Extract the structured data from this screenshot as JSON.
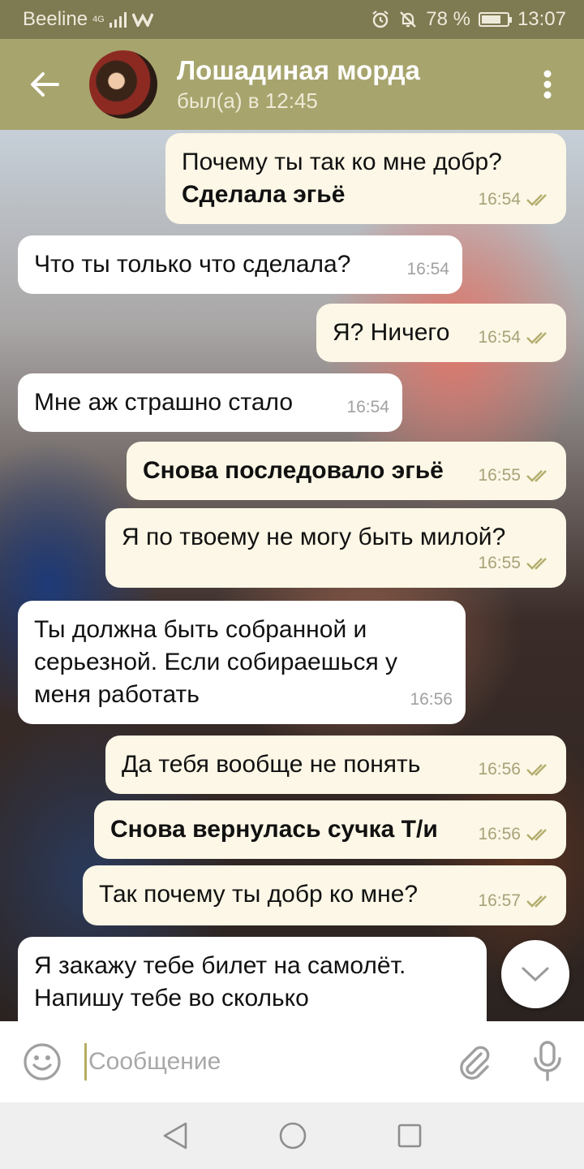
{
  "status_bar": {
    "carrier": "Beeline",
    "network": "4G",
    "battery": "78 %",
    "battery_level": 0.78,
    "time": "13:07"
  },
  "header": {
    "title": "Лошадиная морда",
    "subtitle": "был(а) в 12:45"
  },
  "messages": [
    {
      "direction": "out",
      "lines": [
        "Почему ты так ко мне добр?"
      ],
      "bold": "Сделала эгьё",
      "time": "16:54",
      "read": true
    },
    {
      "direction": "in",
      "lines": [
        "Что ты только что сделала?"
      ],
      "time": "16:54"
    },
    {
      "direction": "out",
      "lines": [
        "Я? Ничего"
      ],
      "time": "16:54",
      "read": true
    },
    {
      "direction": "in",
      "lines": [
        "Мне аж страшно стало"
      ],
      "time": "16:54"
    },
    {
      "direction": "out",
      "bold": "Снова последовало эгьё",
      "time": "16:55",
      "read": true
    },
    {
      "direction": "out",
      "lines": [
        "Я по твоему не могу быть милой?"
      ],
      "time": "16:55",
      "read": true
    },
    {
      "direction": "in",
      "lines": [
        "Ты должна быть собранной и",
        "серьезной. Если собираешься у",
        "меня работать"
      ],
      "time": "16:56"
    },
    {
      "direction": "out",
      "lines": [
        "Да тебя вообще не понять"
      ],
      "time": "16:56",
      "read": true
    },
    {
      "direction": "out",
      "bold": "Снова вернулась сучка Т/и",
      "time": "16:56",
      "read": true
    },
    {
      "direction": "out",
      "lines": [
        "Так почему ты добр ко мне?"
      ],
      "time": "16:57",
      "read": true
    },
    {
      "direction": "in",
      "lines": [
        "Я закажу тебе билет на самолёт.",
        "Напишу тебе во сколько"
      ],
      "time": ""
    }
  ],
  "composer": {
    "placeholder": "Сообщение"
  },
  "colors": {
    "header": "#a7a46d",
    "status_bar": "#7e7a52",
    "outgoing_bubble": "#fcf7e6",
    "incoming_bubble": "#ffffff",
    "read_ticks": "#b4ad6e",
    "cursor": "#b5ad62"
  },
  "icons": {
    "back": "arrow-left-icon",
    "menu": "more-vertical-icon",
    "scroll": "chevron-down-icon",
    "emoji": "smile-icon",
    "attach": "paperclip-icon",
    "mic": "microphone-icon"
  }
}
